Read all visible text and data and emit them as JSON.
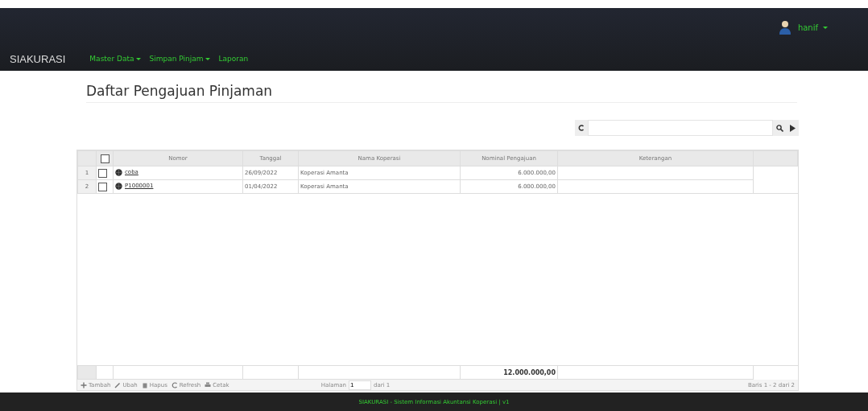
{
  "navbar": {
    "brand": "SIAKURASI",
    "menu": [
      {
        "label": "Master Data",
        "dropdown": true
      },
      {
        "label": "Simpan Pinjam",
        "dropdown": true
      },
      {
        "label": "Laporan",
        "dropdown": false
      }
    ],
    "user": "hanif"
  },
  "page_title": "Daftar Pengajuan Pinjaman",
  "table": {
    "select_all": {
      "checked": false
    },
    "columns": [
      "Nomor",
      "Tanggal",
      "Nama Koperasi",
      "Nominal Pengajuan",
      "Keterangan"
    ],
    "rows": [
      {
        "index": "1",
        "checked": false,
        "nomor": "coba",
        "tanggal": "26/09/2022",
        "nama_koperasi": "Koperasi Amanta",
        "nominal": "6.000.000,00"
      },
      {
        "index": "2",
        "checked": false,
        "nomor": "P1000001",
        "tanggal": "01/04/2022",
        "nama_koperasi": "Koperasi Amanta",
        "nominal": "6.000.000,00"
      }
    ],
    "total": "12.000.000,00"
  },
  "toolbar": [
    {
      "label": "Tambah"
    },
    {
      "label": "Ubah"
    },
    {
      "label": "Hapus"
    },
    {
      "label": "Refresh"
    },
    {
      "label": "Cetak"
    }
  ],
  "pager": {
    "label": "Halaman",
    "page": "1",
    "of": "dari 1",
    "info": "Baris 1 - 2 dari 2"
  },
  "footer": "SIAKURASI - Sistem Informasi Akuntansi Koperasi | v1"
}
